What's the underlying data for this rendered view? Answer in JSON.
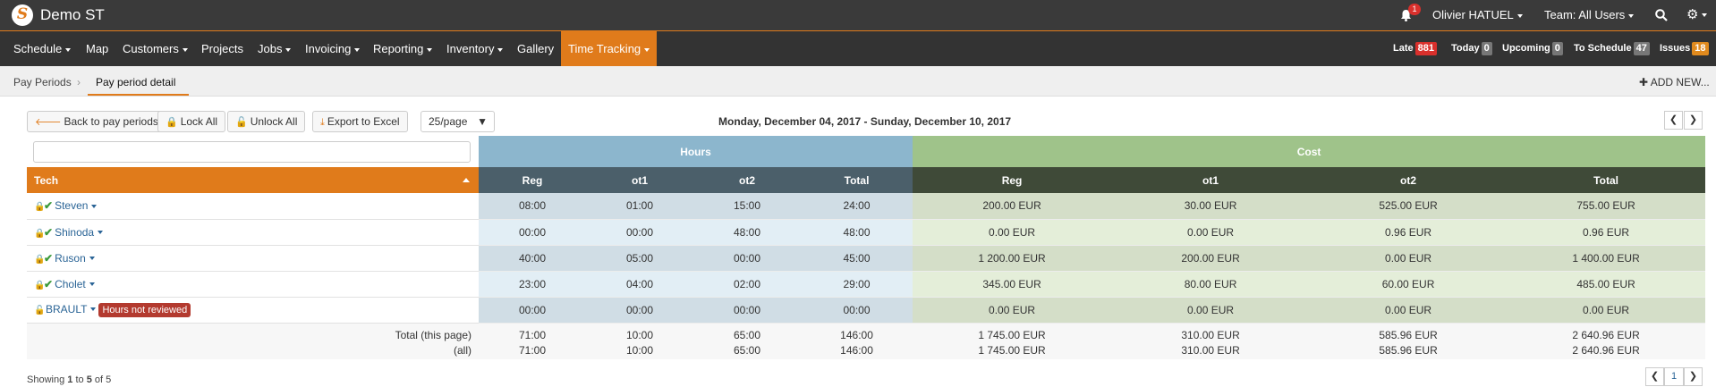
{
  "header": {
    "app_title": "Demo ST",
    "notifications": "1",
    "user": "Olivier HATUEL",
    "team": "Team: All Users"
  },
  "nav": {
    "items": [
      "Schedule",
      "Map",
      "Customers",
      "Projects",
      "Jobs",
      "Invoicing",
      "Reporting",
      "Inventory",
      "Gallery",
      "Time Tracking"
    ],
    "counters": [
      {
        "label": "Late",
        "value": "881",
        "color": "#d9302c"
      },
      {
        "label": "Today",
        "value": "0",
        "color": "#777777"
      },
      {
        "label": "Upcoming",
        "value": "0",
        "color": "#777777"
      },
      {
        "label": "To Schedule",
        "value": "47",
        "color": "#777777"
      },
      {
        "label": "Issues",
        "value": "18",
        "color": "#e08a1e"
      }
    ]
  },
  "breadcrumb": {
    "parent": "Pay Periods",
    "current": "Pay period detail",
    "add_new": "ADD NEW..."
  },
  "toolbar": {
    "back": "Back to pay periods",
    "lock_all": "Lock All",
    "unlock_all": "Unlock All",
    "export": "Export to Excel",
    "per_page": "25/page",
    "period": "Monday, December 04, 2017 - Sunday, December 10, 2017"
  },
  "table": {
    "group_hours": "Hours",
    "group_cost": "Cost",
    "col_tech": "Tech",
    "hours_cols": [
      "Reg",
      "ot1",
      "ot2",
      "Total"
    ],
    "cost_cols": [
      "Reg",
      "ot1",
      "ot2",
      "Total"
    ],
    "rows": [
      {
        "name": "Steven",
        "locked": true,
        "reviewed": true,
        "badge": "",
        "hours": [
          "08:00",
          "01:00",
          "15:00",
          "24:00"
        ],
        "cost": [
          "200.00 EUR",
          "30.00 EUR",
          "525.00 EUR",
          "755.00 EUR"
        ]
      },
      {
        "name": "Shinoda",
        "locked": true,
        "reviewed": true,
        "badge": "",
        "hours": [
          "00:00",
          "00:00",
          "48:00",
          "48:00"
        ],
        "cost": [
          "0.00 EUR",
          "0.00 EUR",
          "0.96 EUR",
          "0.96 EUR"
        ]
      },
      {
        "name": "Ruson",
        "locked": true,
        "reviewed": true,
        "badge": "",
        "hours": [
          "40:00",
          "05:00",
          "00:00",
          "45:00"
        ],
        "cost": [
          "1 200.00 EUR",
          "200.00 EUR",
          "0.00 EUR",
          "1 400.00 EUR"
        ]
      },
      {
        "name": "Cholet",
        "locked": true,
        "reviewed": true,
        "badge": "",
        "hours": [
          "23:00",
          "04:00",
          "02:00",
          "29:00"
        ],
        "cost": [
          "345.00 EUR",
          "80.00 EUR",
          "60.00 EUR",
          "485.00 EUR"
        ]
      },
      {
        "name": "BRAULT",
        "locked": false,
        "reviewed": false,
        "badge": "Hours not reviewed",
        "hours": [
          "00:00",
          "00:00",
          "00:00",
          "00:00"
        ],
        "cost": [
          "0.00 EUR",
          "0.00 EUR",
          "0.00 EUR",
          "0.00 EUR"
        ]
      }
    ],
    "totals": [
      {
        "label": "Total (this page)",
        "hours": [
          "71:00",
          "10:00",
          "65:00",
          "146:00"
        ],
        "cost": [
          "1 745.00 EUR",
          "310.00 EUR",
          "585.96 EUR",
          "2 640.96 EUR"
        ],
        "bold": false
      },
      {
        "label": "(all)",
        "hours": [
          "71:00",
          "10:00",
          "65:00",
          "146:00"
        ],
        "cost": [
          "1 745.00 EUR",
          "310.00 EUR",
          "585.96 EUR",
          "2 640.96 EUR"
        ],
        "bold": true
      }
    ]
  },
  "footer": {
    "showing_prefix": "Showing ",
    "from": "1",
    "to_word": " to ",
    "to": "5",
    "of_word": " of ",
    "total": "5",
    "current_page": "1"
  }
}
